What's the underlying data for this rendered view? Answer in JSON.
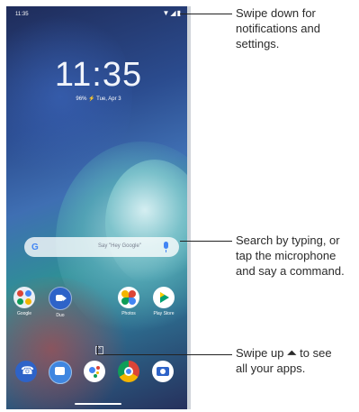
{
  "status_bar": {
    "time": "11:35",
    "icons": "▼◢▮"
  },
  "lock": {
    "clock": "11:35",
    "battery": "96%",
    "date": "Tue, Apr 3"
  },
  "search": {
    "logo": "G",
    "placeholder": "Say \"Hey Google\""
  },
  "apps": [
    {
      "label": "Google",
      "icon": "google-folder-icon"
    },
    {
      "label": "Duo",
      "icon": "duo-icon"
    },
    {
      "label": "Photos",
      "icon": "photos-icon"
    },
    {
      "label": "Play Store",
      "icon": "play-store-icon"
    }
  ],
  "dock": [
    {
      "icon": "phone-icon"
    },
    {
      "icon": "messages-icon"
    },
    {
      "icon": "assistant-icon"
    },
    {
      "icon": "chrome-icon"
    },
    {
      "icon": "camera-icon"
    }
  ],
  "app_drawer_hint": "^",
  "callouts": {
    "status": [
      "Swipe down for",
      "notifications and",
      "settings."
    ],
    "search": [
      "Search by typing, or",
      "tap the microphone",
      "and say a command."
    ],
    "apps": [
      "Swipe up",
      "to see",
      "all your apps."
    ],
    "apps_arrow": "⏶"
  },
  "colors": {
    "text": "#2b2b2b",
    "accent": "#2e63c8",
    "google_blue": "#4285f4"
  }
}
